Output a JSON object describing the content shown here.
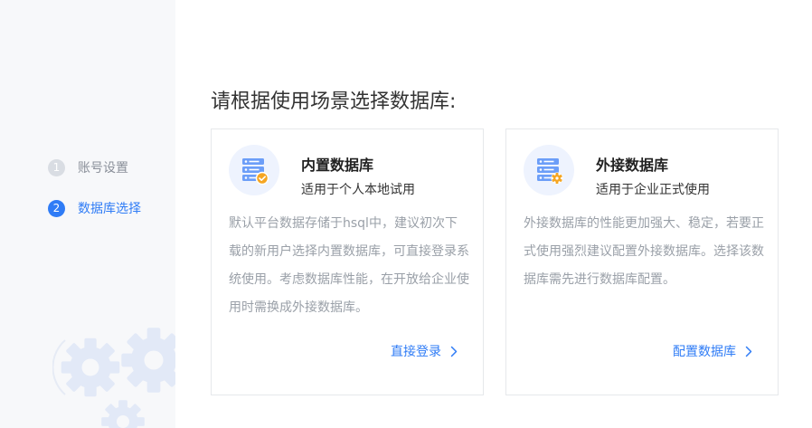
{
  "sidebar": {
    "steps": [
      {
        "number": "1",
        "label": "账号设置",
        "active": false
      },
      {
        "number": "2",
        "label": "数据库选择",
        "active": true
      }
    ]
  },
  "main": {
    "title": "请根据使用场景选择数据库:",
    "cards": [
      {
        "icon": "database-server-check-icon",
        "title": "内置数据库",
        "subtitle": "适用于个人本地试用",
        "description": "默认平台数据存储于hsql中，建议初次下载的新用户选择内置数据库，可直接登录系统使用。考虑数据库性能，在开放给企业使用时需换成外接数据库。",
        "link_label": "直接登录"
      },
      {
        "icon": "database-server-gear-icon",
        "title": "外接数据库",
        "subtitle": "适用于企业正式使用",
        "description": "外接数据库的性能更加强大、稳定，若要正式使用强烈建议配置外接数据库。选择该数据库需先进行数据库配置。",
        "link_label": "配置数据库"
      }
    ]
  },
  "colors": {
    "accent": "#2f7cf6",
    "sidebar_bg": "#f7f8fa",
    "muted_text": "#9aa0a8",
    "step_inactive": "#d9dde3",
    "icon_orange": "#f5a623"
  }
}
